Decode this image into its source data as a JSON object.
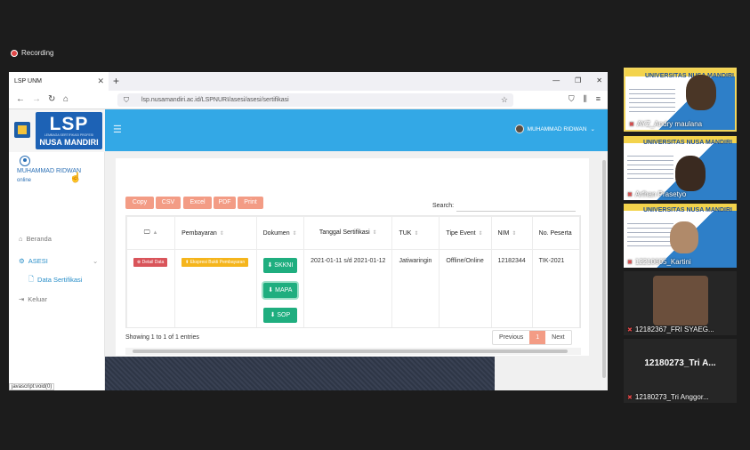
{
  "recording": {
    "label": "Recording"
  },
  "browser": {
    "tab_title": "LSP UNM",
    "url": "lsp.nusamandiri.ac.id/LSPNURI/asesi/asesi/sertifikasi"
  },
  "sidebar": {
    "logo": {
      "text": "LSP",
      "subtitle": "LEMBAGA SERTIFIKASI PROFESI",
      "name": "NUSA MANDIRI"
    },
    "user": {
      "name": "MUHAMMAD RIDWAN",
      "status": "online"
    },
    "items": [
      {
        "label": "Beranda",
        "icon": "home-icon"
      },
      {
        "label": "ASESI",
        "icon": "gears-icon"
      },
      {
        "label": "Data Sertifikasi",
        "icon": "file-icon"
      },
      {
        "label": "Keluar",
        "icon": "logout-icon"
      }
    ]
  },
  "topbar": {
    "user_name": "MUHAMMAD RIDWAN"
  },
  "toolbar": {
    "buttons": [
      "Copy",
      "CSV",
      "Excel",
      "PDF",
      "Print"
    ],
    "search_label": "Search:",
    "search_value": ""
  },
  "table": {
    "columns": [
      "Pembayaran",
      "Dokumen",
      "Tanggal Sertifikasi",
      "TUK",
      "Tipe Event",
      "NIM",
      "No. Peserta"
    ],
    "rows": [
      {
        "detail": "Detail Data",
        "payment": "Ekspresi Bukti Pembayaran",
        "docs": [
          "SKKNI",
          "MAPA",
          "SOP"
        ],
        "tanggal": "2021-01-11 s/d 2021-01-12",
        "tuk": "Jatiwaringin",
        "tipe": "Offline/Online",
        "nim": "12182344",
        "no_peserta": "TIK-2021"
      }
    ]
  },
  "footer": {
    "showing": "Showing 1 to 1 of 1 entries",
    "pager": {
      "prev": "Previous",
      "current": "1",
      "next": "Next"
    }
  },
  "status_bar": "javascript:void(0)",
  "participants": [
    {
      "name": "AYZ_Andry maulana",
      "slide_title": "UNIVERSITAS NUSA MANDIRI"
    },
    {
      "name": "Arfhan Prasetyo",
      "slide_title": "UNIVERSITAS NUSA MANDIRI"
    },
    {
      "name": "12210605_Kartini",
      "slide_title": "UNIVERSITAS NUSA MANDIRI"
    },
    {
      "name": "12182367_FRI SYAEG..."
    },
    {
      "name": "12180273_Tri Anggor...",
      "big_label": "12180273_Tri A..."
    }
  ]
}
